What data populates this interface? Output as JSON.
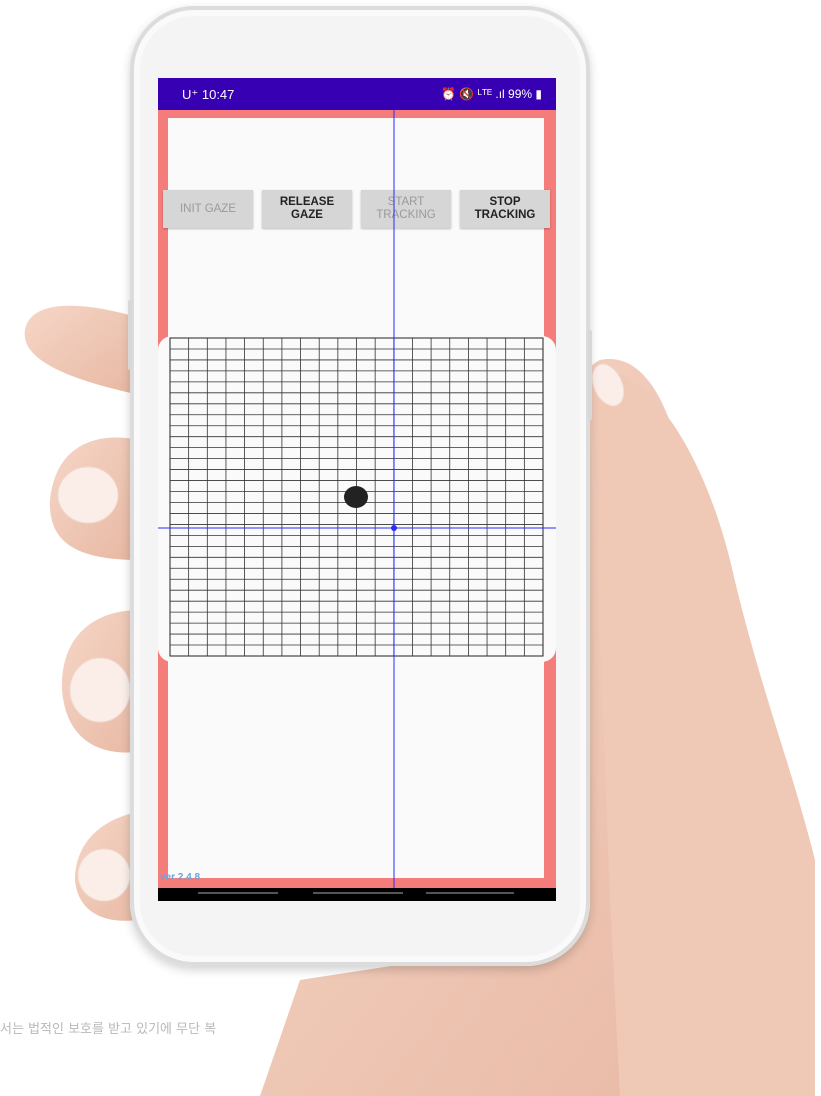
{
  "status_bar": {
    "carrier_time": "U⁺ 10:47",
    "indicators": "⏰ 🔇 ᴸᵀᴱ .ıl 99% ▮"
  },
  "buttons": [
    {
      "label": "INIT GAZE",
      "enabled": false
    },
    {
      "label": "RELEASE\nGAZE",
      "enabled": true
    },
    {
      "label": "START\nTRACKING",
      "enabled": false
    },
    {
      "label": "STOP\nTRACKING",
      "enabled": true
    }
  ],
  "version_label": "ver 2.4.8",
  "watermark": "서는 법적인 보호를 받고 있기에 무단 복",
  "colors": {
    "status_bar": "#3700b3",
    "app_border": "#f47c7a",
    "crosshair": "#2b2bff",
    "gaze_dot": "#222222"
  },
  "icons": [
    "alarm-icon",
    "mute-icon",
    "lte-icon",
    "signal-icon",
    "battery-icon"
  ]
}
